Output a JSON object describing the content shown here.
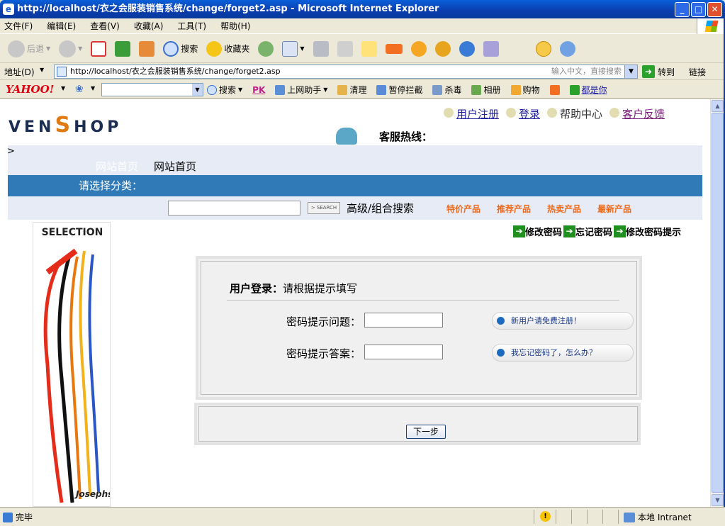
{
  "window": {
    "title": "http://localhost/衣之会服装销售系统/change/forget2.asp - Microsoft Internet Explorer"
  },
  "menu": [
    "文件(F)",
    "编辑(E)",
    "查看(V)",
    "收藏(A)",
    "工具(T)",
    "帮助(H)"
  ],
  "toolbar": {
    "back": "后退",
    "search": "搜索",
    "favorites": "收藏夹"
  },
  "address": {
    "label": "地址(D)",
    "url": "http://localhost/衣之会服装销售系统/change/forget2.asp",
    "hint": "输入中文，直接搜索",
    "go": "转到",
    "links": "链接"
  },
  "yahoo": {
    "logo": "YAHOO!",
    "items": [
      "搜索",
      "PK",
      "上网助手",
      "清理",
      "暂停拦截",
      "杀毒",
      "相册",
      "购物",
      "都是你"
    ]
  },
  "site": {
    "logo_left": "VEN",
    "logo_s": "S",
    "logo_right": "HOP",
    "toplinks": {
      "register": "用户注册",
      "login": "登录",
      "help": "帮助中心",
      "feedback": "客户反馈"
    },
    "hotline": "客服热线：",
    "nav_ghost": "网站首页",
    "nav_home": "网站首页",
    "category_prompt": "请选择分类：",
    "search_button": "> SEARCH",
    "advanced_search": "高级/组合搜索",
    "categories": [
      "特价产品",
      "推荐产品",
      "热卖产品",
      "最新产品"
    ],
    "pw_links": [
      "修改密码",
      "忘记密码",
      "修改密码提示"
    ],
    "banner_title": "SELECTION",
    "banner_brand": "Josephson"
  },
  "login": {
    "title_bold": "用户登录：",
    "title_rest": "请根据提示填写",
    "question_label": "密码提示问题：",
    "answer_label": "密码提示答案：",
    "question_value": "",
    "answer_value": "",
    "register_link": "新用户请免费注册！",
    "forgot_link": "我忘记密码了，怎么办？",
    "next_button": "下一步"
  },
  "status": {
    "text": "完毕",
    "zone": "本地 Intranet"
  }
}
